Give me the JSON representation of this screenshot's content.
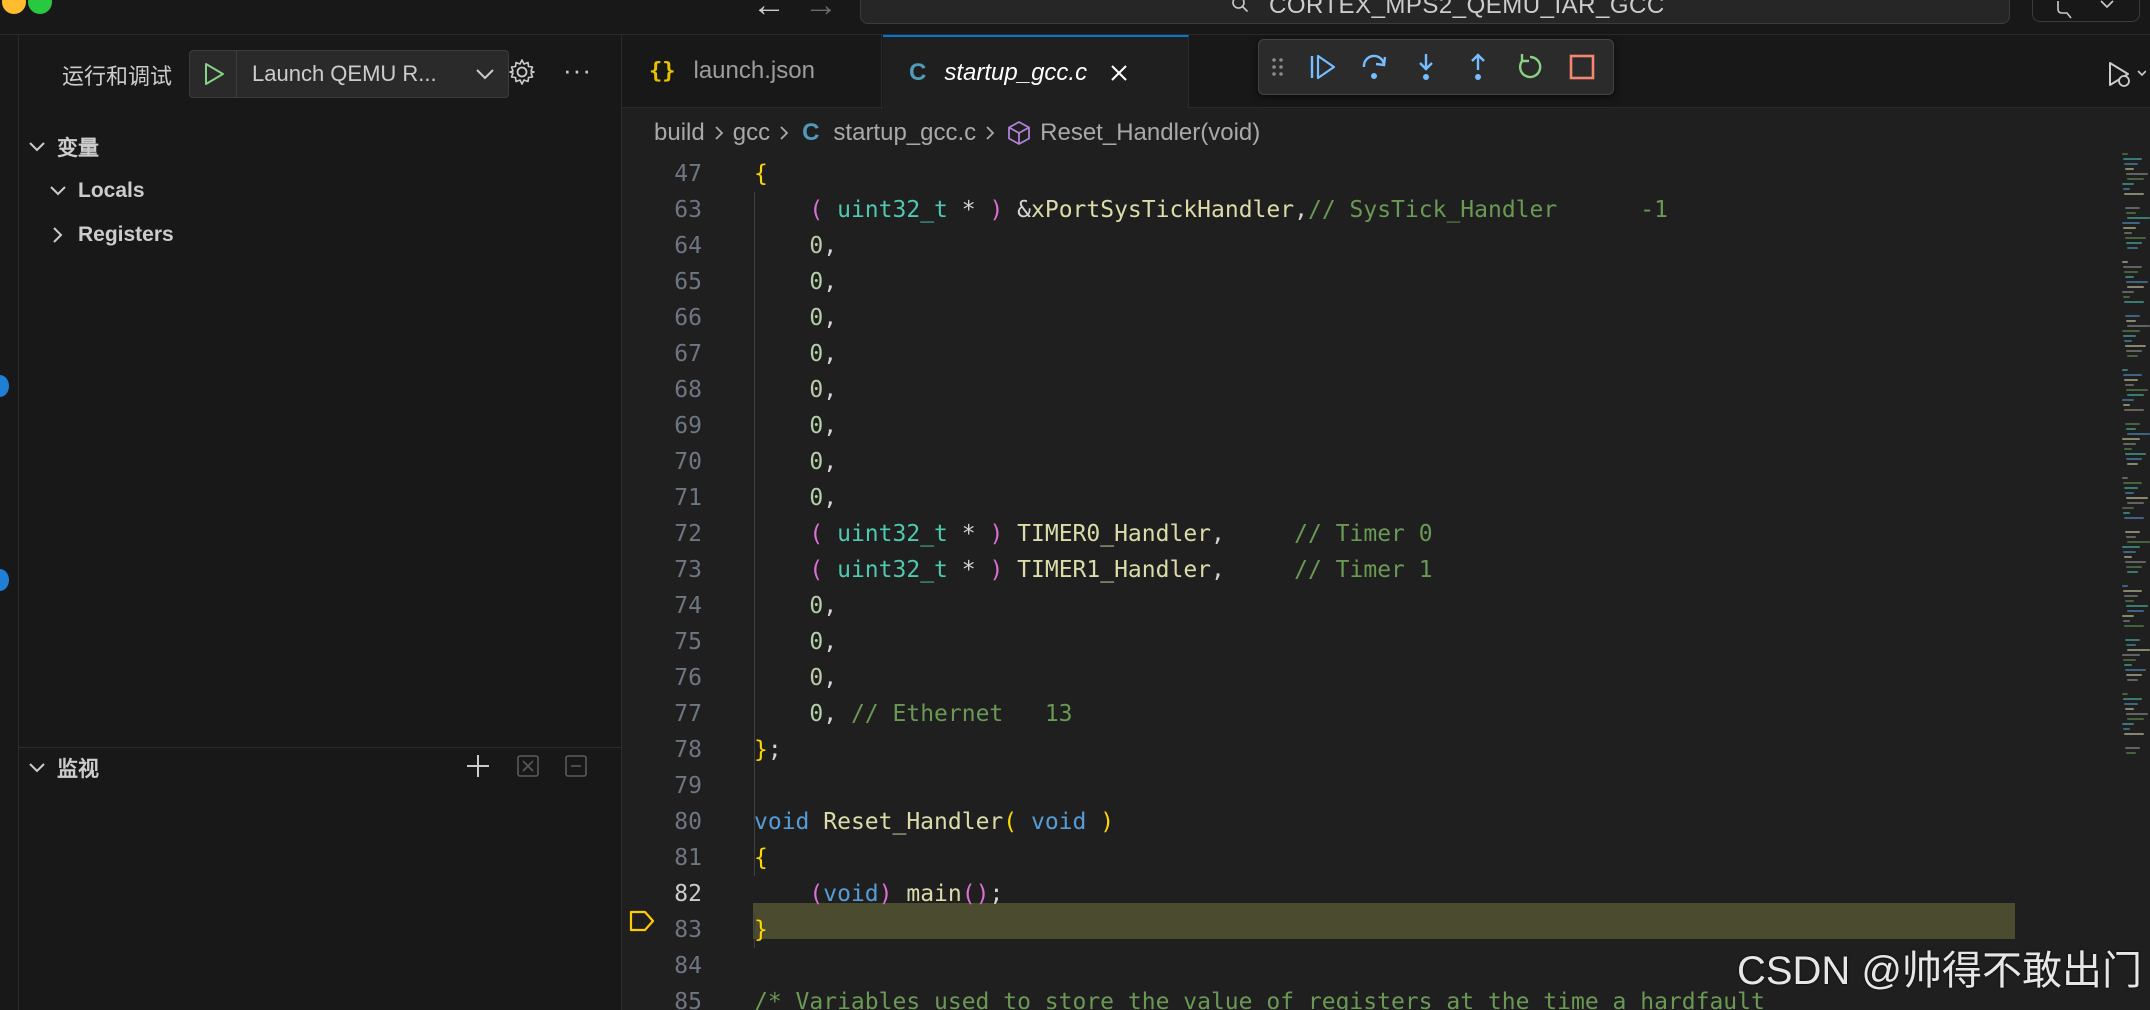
{
  "titlebar": {
    "command_center_text": "CORTEX_MPS2_QEMU_IAR_GCC"
  },
  "sidebar": {
    "title": "运行和调试",
    "config_label": "Launch QEMU R...",
    "more_label": "···",
    "variables_title": "变量",
    "locals_label": "Locals",
    "registers_label": "Registers",
    "watch_title": "监视"
  },
  "editor": {
    "tabs": [
      {
        "icon": "{}",
        "label": "launch.json"
      },
      {
        "icon": "C",
        "label": "startup_gcc.c"
      }
    ],
    "breadcrumb": {
      "folder1": "build",
      "folder2": "gcc",
      "file_icon": "C",
      "file": "startup_gcc.c",
      "symbol": "Reset_Handler(void)"
    },
    "current_line": 82,
    "code_lines": [
      {
        "n": "47",
        "tokens": [
          [
            "p1",
            "{"
          ]
        ]
      },
      {
        "n": "63",
        "tokens": [
          [
            "tx",
            "    "
          ],
          [
            "p2",
            "("
          ],
          [
            "tx",
            " "
          ],
          [
            "ty",
            "uint32_t"
          ],
          [
            "tx",
            " * "
          ],
          [
            "p2",
            ")"
          ],
          [
            "tx",
            " &"
          ],
          [
            "id",
            "xPortSysTickHandler"
          ],
          [
            "tx",
            ","
          ],
          [
            "cm",
            "// SysTick_Handler      -1"
          ]
        ]
      },
      {
        "n": "64",
        "tokens": [
          [
            "tx",
            "    "
          ],
          [
            "nm",
            "0"
          ],
          [
            "tx",
            ","
          ]
        ]
      },
      {
        "n": "65",
        "tokens": [
          [
            "tx",
            "    "
          ],
          [
            "nm",
            "0"
          ],
          [
            "tx",
            ","
          ]
        ]
      },
      {
        "n": "66",
        "tokens": [
          [
            "tx",
            "    "
          ],
          [
            "nm",
            "0"
          ],
          [
            "tx",
            ","
          ]
        ]
      },
      {
        "n": "67",
        "tokens": [
          [
            "tx",
            "    "
          ],
          [
            "nm",
            "0"
          ],
          [
            "tx",
            ","
          ]
        ]
      },
      {
        "n": "68",
        "tokens": [
          [
            "tx",
            "    "
          ],
          [
            "nm",
            "0"
          ],
          [
            "tx",
            ","
          ]
        ]
      },
      {
        "n": "69",
        "tokens": [
          [
            "tx",
            "    "
          ],
          [
            "nm",
            "0"
          ],
          [
            "tx",
            ","
          ]
        ]
      },
      {
        "n": "70",
        "tokens": [
          [
            "tx",
            "    "
          ],
          [
            "nm",
            "0"
          ],
          [
            "tx",
            ","
          ]
        ]
      },
      {
        "n": "71",
        "tokens": [
          [
            "tx",
            "    "
          ],
          [
            "nm",
            "0"
          ],
          [
            "tx",
            ","
          ]
        ]
      },
      {
        "n": "72",
        "tokens": [
          [
            "tx",
            "    "
          ],
          [
            "p2",
            "("
          ],
          [
            "tx",
            " "
          ],
          [
            "ty",
            "uint32_t"
          ],
          [
            "tx",
            " * "
          ],
          [
            "p2",
            ")"
          ],
          [
            "tx",
            " "
          ],
          [
            "id",
            "TIMER0_Handler"
          ],
          [
            "tx",
            ",     "
          ],
          [
            "cm",
            "// Timer 0"
          ]
        ]
      },
      {
        "n": "73",
        "tokens": [
          [
            "tx",
            "    "
          ],
          [
            "p2",
            "("
          ],
          [
            "tx",
            " "
          ],
          [
            "ty",
            "uint32_t"
          ],
          [
            "tx",
            " * "
          ],
          [
            "p2",
            ")"
          ],
          [
            "tx",
            " "
          ],
          [
            "id",
            "TIMER1_Handler"
          ],
          [
            "tx",
            ",     "
          ],
          [
            "cm",
            "// Timer 1"
          ]
        ]
      },
      {
        "n": "74",
        "tokens": [
          [
            "tx",
            "    "
          ],
          [
            "nm",
            "0"
          ],
          [
            "tx",
            ","
          ]
        ]
      },
      {
        "n": "75",
        "tokens": [
          [
            "tx",
            "    "
          ],
          [
            "nm",
            "0"
          ],
          [
            "tx",
            ","
          ]
        ]
      },
      {
        "n": "76",
        "tokens": [
          [
            "tx",
            "    "
          ],
          [
            "nm",
            "0"
          ],
          [
            "tx",
            ","
          ]
        ]
      },
      {
        "n": "77",
        "tokens": [
          [
            "tx",
            "    "
          ],
          [
            "nm",
            "0"
          ],
          [
            "tx",
            ", "
          ],
          [
            "cm",
            "// Ethernet   13"
          ]
        ]
      },
      {
        "n": "78",
        "tokens": [
          [
            "p1",
            "}"
          ],
          [
            "tx",
            ";"
          ]
        ]
      },
      {
        "n": "79",
        "tokens": []
      },
      {
        "n": "80",
        "tokens": [
          [
            "kw",
            "void"
          ],
          [
            "tx",
            " "
          ],
          [
            "fn",
            "Reset_Handler"
          ],
          [
            "p1",
            "("
          ],
          [
            "tx",
            " "
          ],
          [
            "kw",
            "void"
          ],
          [
            "tx",
            " "
          ],
          [
            "p1",
            ")"
          ]
        ]
      },
      {
        "n": "81",
        "tokens": [
          [
            "p1",
            "{"
          ]
        ]
      },
      {
        "n": "82",
        "tokens": [
          [
            "tx",
            "    "
          ],
          [
            "p2",
            "("
          ],
          [
            "kw",
            "void"
          ],
          [
            "p2",
            ")"
          ],
          [
            "tx",
            " "
          ],
          [
            "fn",
            "main"
          ],
          [
            "p2",
            "()"
          ],
          [
            "tx",
            ";"
          ]
        ]
      },
      {
        "n": "83",
        "tokens": [
          [
            "p1",
            "}"
          ]
        ]
      },
      {
        "n": "84",
        "tokens": []
      },
      {
        "n": "85",
        "tokens": [
          [
            "cm",
            "/* Variables used to store the value of registers at the time a hardfault"
          ]
        ]
      }
    ]
  },
  "watermark": "CSDN @帅得不敢出门",
  "colors": {
    "accent": "#0078d4",
    "current_line_bg": "#4b4b2f",
    "breakpoint_yellow": "#ffcc00",
    "debug_continue": "#75beff",
    "debug_restart": "#89d185",
    "debug_stop": "#f48771"
  },
  "icons": {
    "start": "play-icon",
    "settings": "gear-icon",
    "debug_toolbar": [
      "drag-handle-icon",
      "continue-icon",
      "step-over-icon",
      "step-into-icon",
      "step-out-icon",
      "restart-icon",
      "stop-icon"
    ]
  }
}
